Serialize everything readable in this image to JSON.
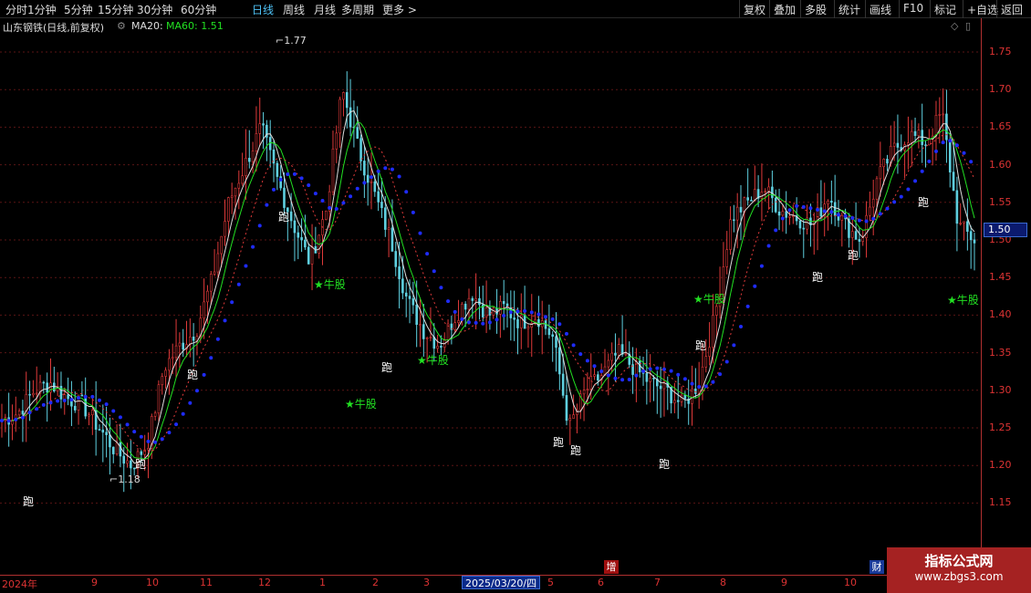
{
  "toolbar": {
    "periods": [
      "分时",
      "1分钟",
      "5分钟",
      "15分钟",
      "30分钟",
      "60分钟",
      "日线",
      "周线",
      "月线",
      "多周期",
      "更多 >"
    ],
    "active": "日线",
    "right_buttons": [
      "复权",
      "叠加",
      "多股",
      "统计",
      "画线",
      "F10",
      "标记",
      "+自选",
      "返回"
    ]
  },
  "info": {
    "stock": "山东钢铁(日线,前复权)",
    "ma20_label": "MA20:",
    "ma60_label": "MA60: 1.51",
    "ma20_color": "#ffffff",
    "ma60_color": "#22e022"
  },
  "price_axis": {
    "ticks": [
      "1.75",
      "1.70",
      "1.65",
      "1.60",
      "1.55",
      "1.50",
      "1.45",
      "1.40",
      "1.35",
      "1.30",
      "1.25",
      "1.20",
      "1.15"
    ],
    "current": "1.50"
  },
  "date_axis": {
    "labels": [
      "2024年",
      "9",
      "10",
      "11",
      "12",
      "1",
      "2",
      "3",
      "5",
      "6",
      "7",
      "8",
      "9",
      "10"
    ],
    "cursor": "2025/03/20/四"
  },
  "annotations": {
    "high": "1.77",
    "low": "1.18"
  },
  "signals": {
    "run": "跑",
    "bull": "★牛股"
  },
  "badges": {
    "zeng": "增",
    "cai": "财"
  },
  "watermark": {
    "line1": "指标公式网",
    "line2": "www.zbgs3.com"
  },
  "colors": {
    "background": "#000000",
    "up_candle": "#e03a3a",
    "down_candle": "#5fd0e0",
    "ma_fast": "#22e022",
    "ma_slow": "#e03a3a",
    "trend_dots": "#1f2cff"
  },
  "chart_data": {
    "type": "candlestick",
    "ylim": [
      1.1,
      1.8
    ],
    "close_path": [
      1.26,
      1.27,
      1.3,
      1.31,
      1.29,
      1.28,
      1.25,
      1.22,
      1.2,
      1.23,
      1.33,
      1.36,
      1.38,
      1.45,
      1.55,
      1.6,
      1.65,
      1.58,
      1.52,
      1.47,
      1.54,
      1.7,
      1.62,
      1.56,
      1.5,
      1.42,
      1.38,
      1.36,
      1.4,
      1.43,
      1.4,
      1.41,
      1.39,
      1.4,
      1.37,
      1.25,
      1.3,
      1.32,
      1.35,
      1.33,
      1.31,
      1.3,
      1.28,
      1.31,
      1.4,
      1.53,
      1.55,
      1.57,
      1.54,
      1.53,
      1.52,
      1.56,
      1.52,
      1.5,
      1.58,
      1.62,
      1.64,
      1.63,
      1.67,
      1.52,
      1.5
    ]
  }
}
